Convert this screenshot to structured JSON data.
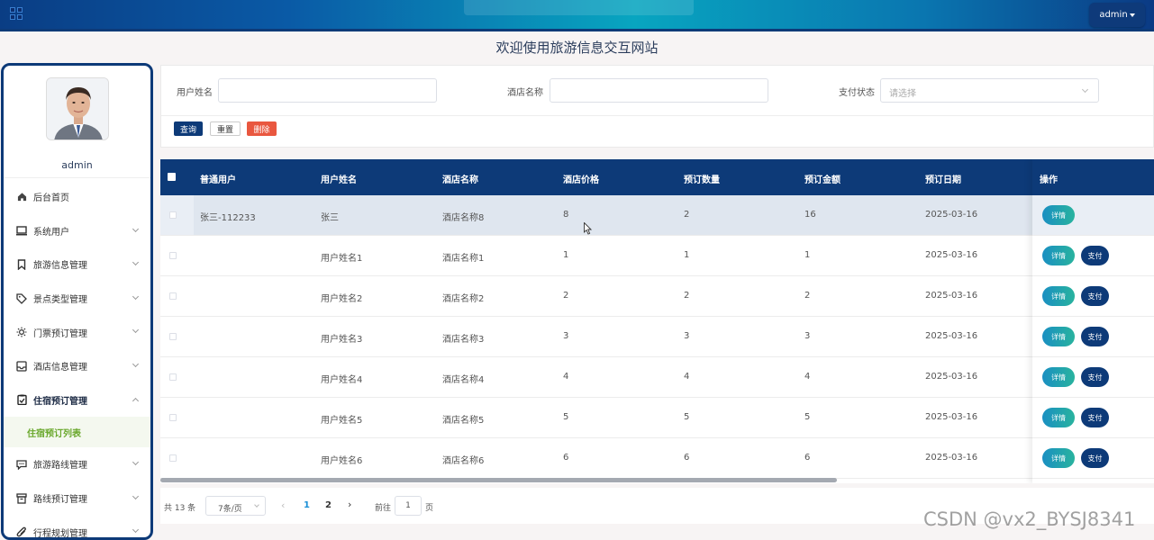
{
  "header": {
    "user_button": "admin"
  },
  "site_title": "欢迎使用旅游信息交互网站",
  "sidebar": {
    "username": "admin",
    "items": [
      {
        "label": "后台首页",
        "icon": "home-icon"
      },
      {
        "label": "系统用户",
        "icon": "monitor-icon"
      },
      {
        "label": "旅游信息管理",
        "icon": "bookmark-icon"
      },
      {
        "label": "景点类型管理",
        "icon": "tag-icon"
      },
      {
        "label": "门票预订管理",
        "icon": "sun-icon"
      },
      {
        "label": "酒店信息管理",
        "icon": "inbox-icon"
      },
      {
        "label": "住宿预订管理",
        "icon": "clipboard-check-icon"
      },
      {
        "label": "旅游路线管理",
        "icon": "chat-icon"
      },
      {
        "label": "路线预订管理",
        "icon": "archive-icon"
      },
      {
        "label": "行程规划管理",
        "icon": "paperclip-icon"
      }
    ],
    "submenu_active": "住宿预订列表"
  },
  "search": {
    "username_label": "用户姓名",
    "hotel_label": "酒店名称",
    "pay_status_label": "支付状态",
    "pay_status_placeholder": "请选择",
    "query_button": "查询",
    "reset_button": "重置",
    "delete_button": "删除"
  },
  "table": {
    "columns": [
      "普通用户",
      "用户姓名",
      "酒店名称",
      "酒店价格",
      "预订数量",
      "预订金额",
      "预订日期",
      "操作"
    ],
    "rows": [
      {
        "user": "张三-112233",
        "name": "张三",
        "hotel": "酒店名称8",
        "price": "8",
        "qty": "2",
        "amount": "16",
        "date": "2025-03-16",
        "paid": true
      },
      {
        "user": "",
        "name": "用户姓名1",
        "hotel": "酒店名称1",
        "price": "1",
        "qty": "1",
        "amount": "1",
        "date": "2025-03-16",
        "paid": false
      },
      {
        "user": "",
        "name": "用户姓名2",
        "hotel": "酒店名称2",
        "price": "2",
        "qty": "2",
        "amount": "2",
        "date": "2025-03-16",
        "paid": false
      },
      {
        "user": "",
        "name": "用户姓名3",
        "hotel": "酒店名称3",
        "price": "3",
        "qty": "3",
        "amount": "3",
        "date": "2025-03-16",
        "paid": false
      },
      {
        "user": "",
        "name": "用户姓名4",
        "hotel": "酒店名称4",
        "price": "4",
        "qty": "4",
        "amount": "4",
        "date": "2025-03-16",
        "paid": false
      },
      {
        "user": "",
        "name": "用户姓名5",
        "hotel": "酒店名称5",
        "price": "5",
        "qty": "5",
        "amount": "5",
        "date": "2025-03-16",
        "paid": false
      },
      {
        "user": "",
        "name": "用户姓名6",
        "hotel": "酒店名称6",
        "price": "6",
        "qty": "6",
        "amount": "6",
        "date": "2025-03-16",
        "paid": false
      }
    ],
    "detail_label": "详情",
    "pay_label": "支付"
  },
  "pager": {
    "total": "共 13 条",
    "page_size": "7条/页",
    "pages": [
      "1",
      "2"
    ],
    "goto_label": "前往",
    "goto_value": "1",
    "page_suffix": "页"
  },
  "watermark": "CSDN @vx2_BYSJ8341",
  "colors": {
    "primary": "#0d3a78",
    "danger": "#e9573f",
    "active_sub": "#6aa82d"
  }
}
